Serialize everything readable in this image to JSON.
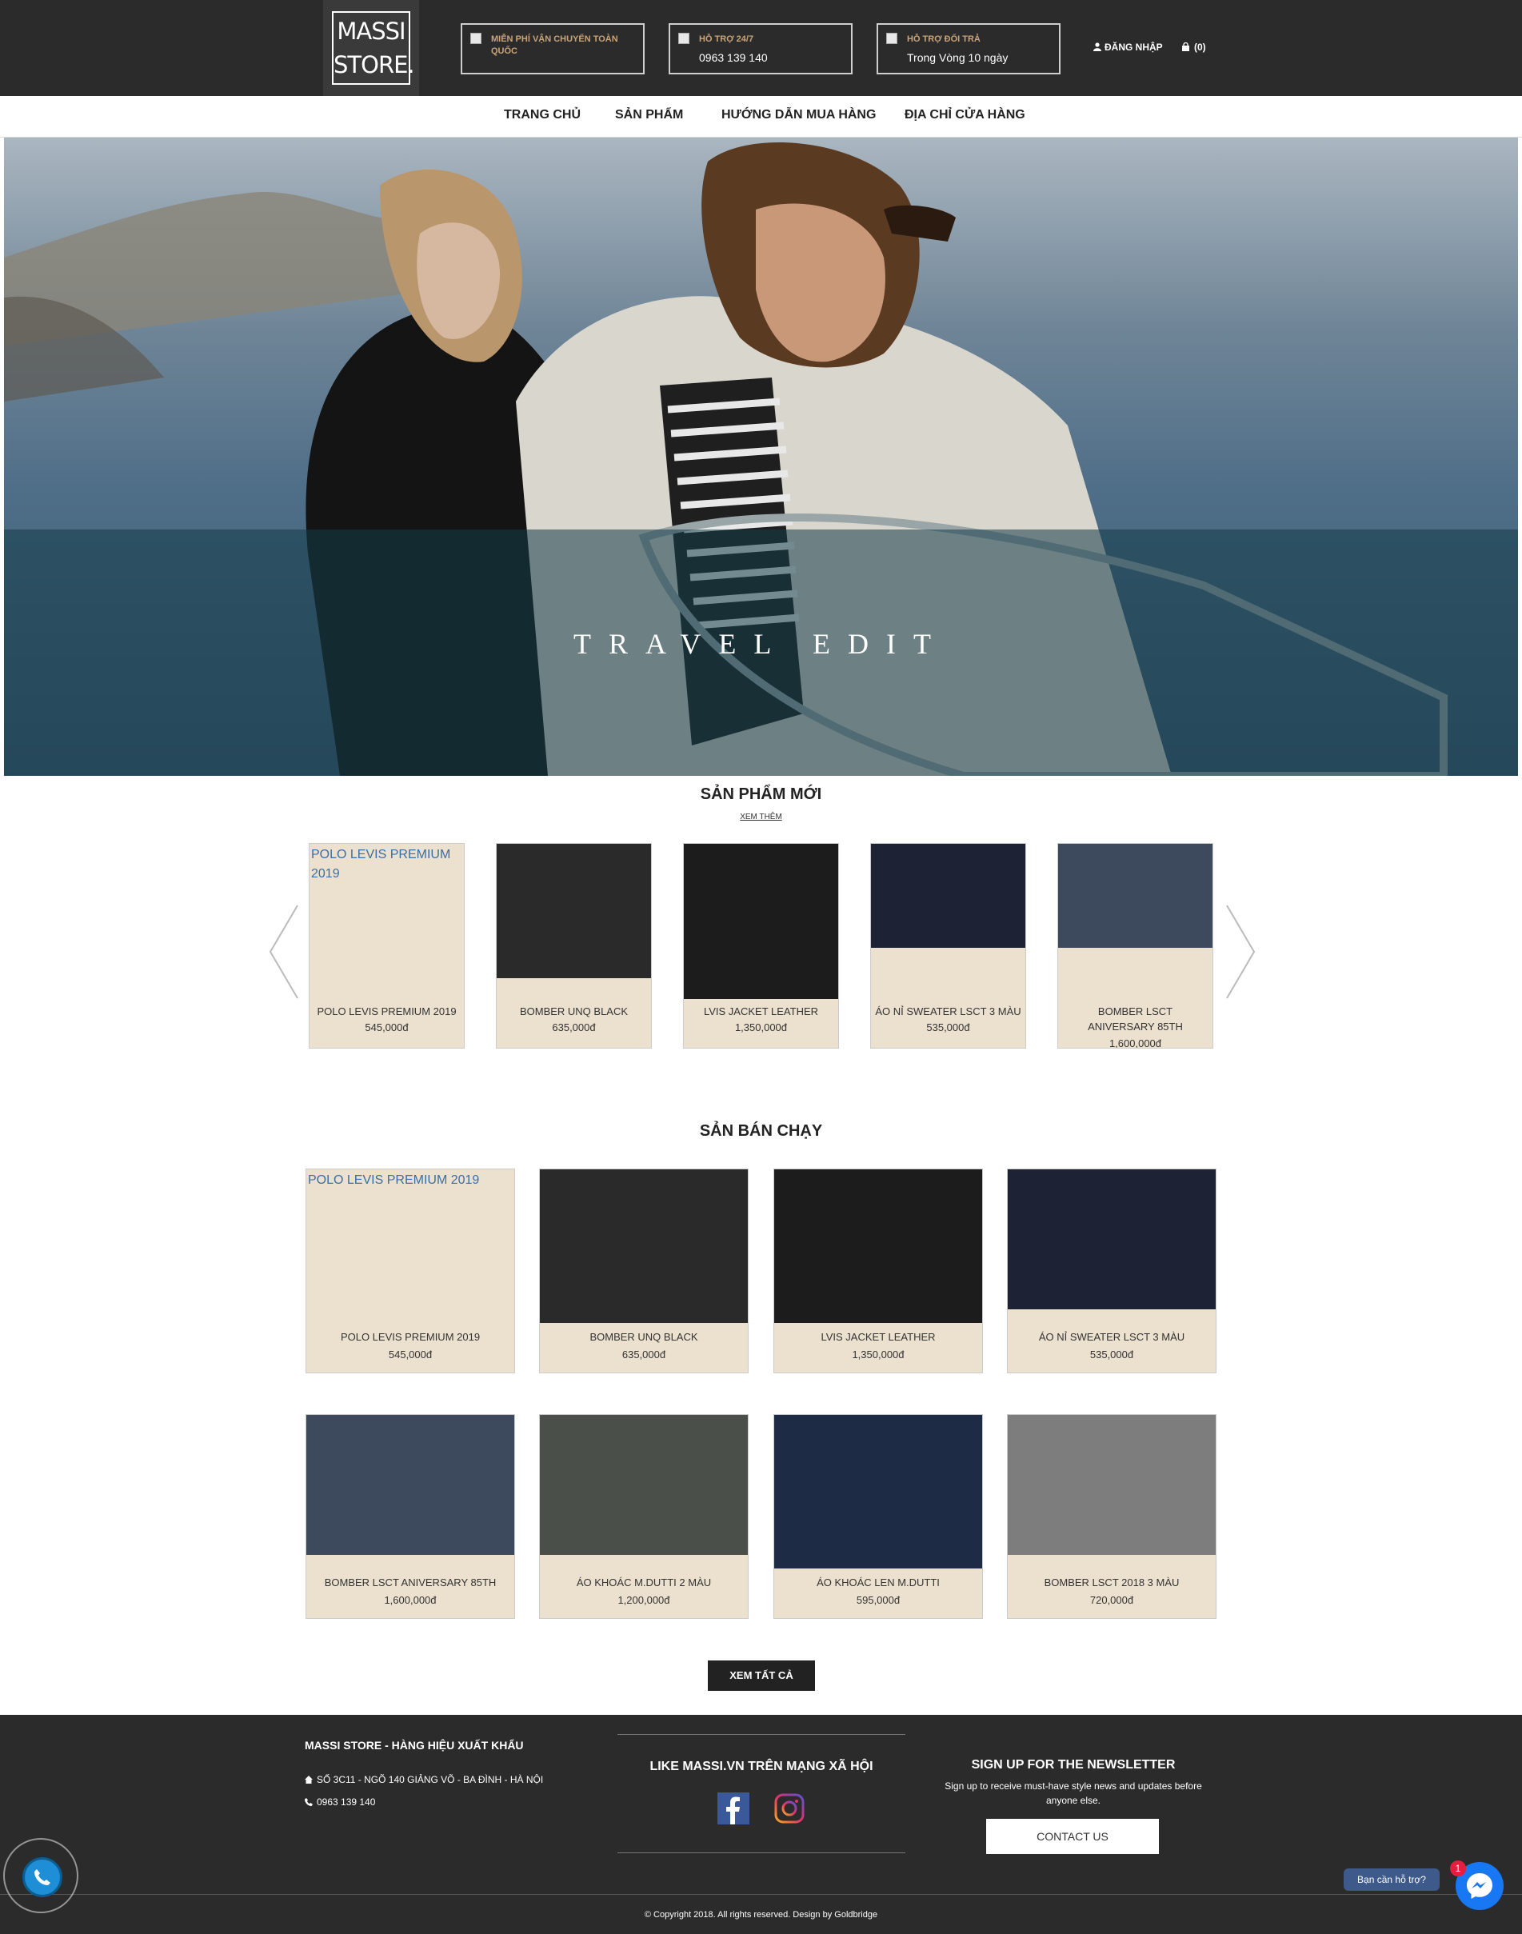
{
  "header": {
    "logo_line1": "MASSI",
    "logo_line2": "STORE.",
    "info_boxes": [
      {
        "title": "MIỄN PHÍ VẬN CHUYỂN TOÀN QUỐC",
        "value": ""
      },
      {
        "title": "HỖ TRỢ 24/7",
        "value": "0963 139 140"
      },
      {
        "title": "HỖ TRỢ ĐỔI TRẢ",
        "value": "Trong Vòng 10 ngày"
      }
    ],
    "login_label": "ĐĂNG NHẬP",
    "cart_label": "(0)"
  },
  "nav": {
    "items": [
      "TRANG CHỦ",
      "SẢN PHẨM",
      "HƯỚNG DẪN MUA HÀNG",
      "ĐỊA CHỈ CỬA HÀNG"
    ]
  },
  "hero": {
    "caption": "TRAVEL EDIT"
  },
  "new_products": {
    "title": "SẢN PHẨM MỚI",
    "more_link": "XEM THÊM",
    "items": [
      {
        "name": "POLO LEVIS PREMIUM 2019",
        "price": "545,000đ",
        "alt": "POLO LEVIS PREMIUM 2019",
        "tone": "#ece1cf"
      },
      {
        "name": "BOMBER UNQ BLACK",
        "price": "635,000đ",
        "tone": "#2a2a2a"
      },
      {
        "name": "LVIS JACKET LEATHER",
        "price": "1,350,000đ",
        "tone": "#1c1c1c"
      },
      {
        "name": "ÁO NỈ SWEATER LSCT 3 MÀU",
        "price": "535,000đ",
        "tone": "#1d2235"
      },
      {
        "name": "BOMBER LSCT ANIVERSARY 85TH",
        "price": "1,600,000đ",
        "tone": "#3d4a5e"
      }
    ]
  },
  "best_sellers": {
    "title": "SẢN BÁN CHẠY",
    "items": [
      {
        "name": "POLO LEVIS PREMIUM 2019",
        "price": "545,000đ",
        "alt": "POLO LEVIS PREMIUM 2019",
        "tone": "#ece1cf"
      },
      {
        "name": "BOMBER UNQ BLACK",
        "price": "635,000đ",
        "tone": "#2a2a2a"
      },
      {
        "name": "LVIS JACKET LEATHER",
        "price": "1,350,000đ",
        "tone": "#1c1c1c"
      },
      {
        "name": "ÁO NỈ SWEATER LSCT 3 MÀU",
        "price": "535,000đ",
        "tone": "#1d2235"
      },
      {
        "name": "BOMBER LSCT ANIVERSARY 85TH",
        "price": "1,600,000đ",
        "tone": "#3d4a5e"
      },
      {
        "name": "ÁO KHOÁC M.DUTTI 2 MÀU",
        "price": "1,200,000đ",
        "tone": "#4a4f4a"
      },
      {
        "name": "ÁO KHOÁC LEN M.DUTTI",
        "price": "595,000đ",
        "tone": "#1e2b45"
      },
      {
        "name": "BOMBER LSCT 2018 3 MÀU",
        "price": "720,000đ",
        "tone": "#7d7d7d"
      }
    ],
    "view_all": "XEM TẤT CẢ"
  },
  "footer": {
    "brand": "MASSI STORE - HÀNG HIỆU XUẤT KHẨU",
    "address": "SỐ 3C11 - NGÕ 140 GIẢNG VÕ - BA ĐÌNH - HÀ NỘI",
    "phone": "0963 139 140",
    "social_title": "LIKE MASSI.VN TRÊN MẠNG XÃ HỘI",
    "newsletter_title": "SIGN UP FOR THE NEWSLETTER",
    "newsletter_text": "Sign up to receive must-have style news and updates before anyone else.",
    "contact_button": "CONTACT US",
    "copyright": "© Copyright 2018. All rights reserved. Design by Goldbridge"
  },
  "floating": {
    "support_label": "Bạn cần hỗ trợ?",
    "badge_count": "1"
  },
  "colors": {
    "dark": "#2b2b2b",
    "card_bg": "#ece1cf",
    "messenger": "#1877f2",
    "call": "#1e8fd6"
  }
}
